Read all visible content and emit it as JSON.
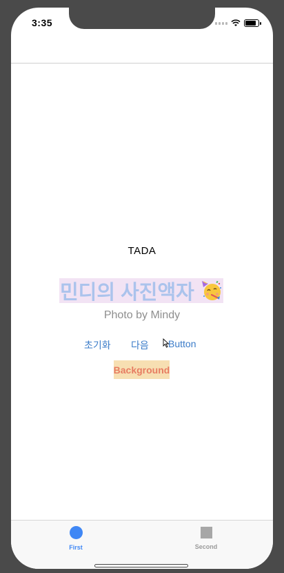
{
  "status_bar": {
    "time": "3:35"
  },
  "main": {
    "tada_label": "TADA",
    "title": "민디의 사진액자",
    "subtitle": "Photo by Mindy",
    "buttons": {
      "reset": "초기화",
      "next": "다음",
      "button": "Button"
    },
    "background_button": "Background"
  },
  "tab_bar": {
    "tabs": [
      {
        "label": "First",
        "selected": true,
        "icon": "circle-icon"
      },
      {
        "label": "Second",
        "selected": false,
        "icon": "square-icon"
      }
    ]
  },
  "colors": {
    "accent": "#3f87f5",
    "title_text": "#abc3ec",
    "title_bg": "#f2e3f4",
    "background_button_bg": "#f7dfb2",
    "background_button_text": "#e77d62"
  }
}
